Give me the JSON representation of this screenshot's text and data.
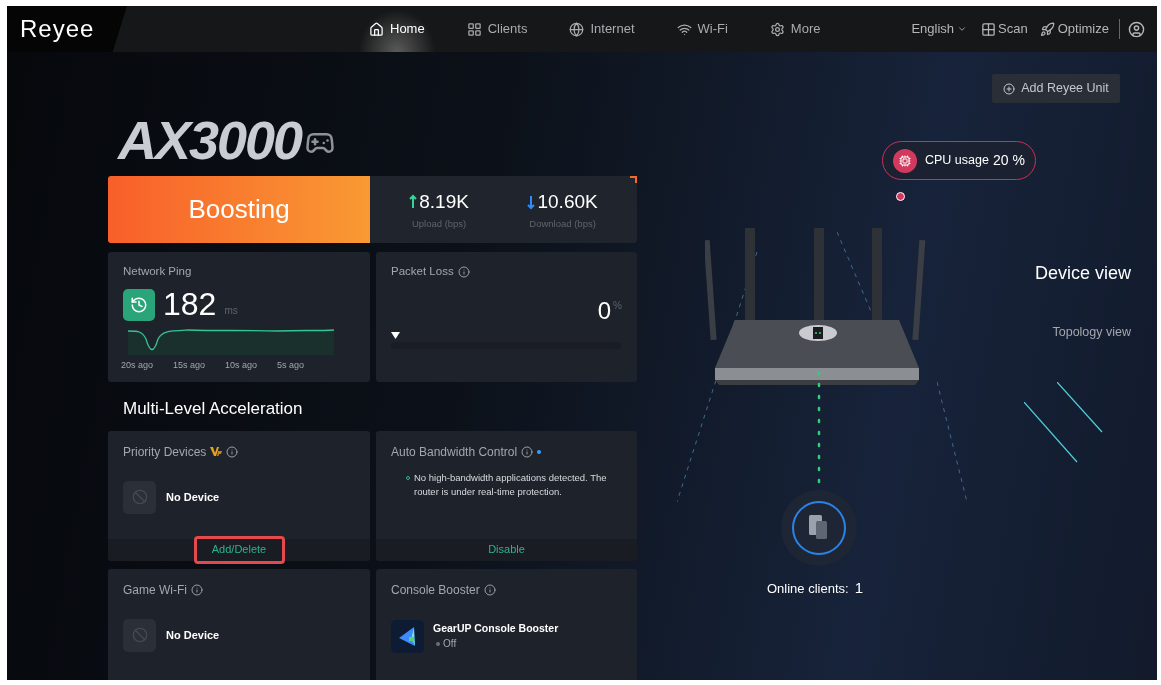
{
  "brand": "Reyee",
  "nav": [
    {
      "label": "Home",
      "selected": true
    },
    {
      "label": "Clients",
      "selected": false
    },
    {
      "label": "Internet",
      "selected": false
    },
    {
      "label": "Wi-Fi",
      "selected": false
    },
    {
      "label": "More",
      "selected": false
    }
  ],
  "toolbar": {
    "language": "English",
    "scan": "Scan",
    "optimize": "Optimize"
  },
  "product_logo": "AX3000",
  "boost": {
    "status": "Boosting",
    "upload": {
      "value": "8.19K",
      "label": "Upload (bps)"
    },
    "download": {
      "value": "10.60K",
      "label": "Download (bps)"
    }
  },
  "ping": {
    "title": "Network Ping",
    "value": "182",
    "unit": "ms",
    "time_labels": [
      "20s ago",
      "15s ago",
      "10s ago",
      "5s ago"
    ]
  },
  "packet_loss": {
    "title": "Packet Loss",
    "value": "0",
    "unit": "%",
    "level": 0
  },
  "section_title": "Multi-Level Acceleration",
  "cards": [
    {
      "kind": "device",
      "title": "Priority Devices",
      "vip": true,
      "empty_text": "No Device",
      "action": "Add/Delete",
      "highlighted": true
    },
    {
      "kind": "message",
      "title": "Auto Bandwidth Control",
      "dot": true,
      "message": "No high-bandwidth applications detected. The router is under real-time protection.",
      "action": "Disable",
      "highlighted": false
    },
    {
      "kind": "device",
      "title": "Game Wi-Fi",
      "vip": false,
      "empty_text": "No Device"
    },
    {
      "kind": "app",
      "title": "Console Booster",
      "app_name": "GearUP Console Booster",
      "status": "Off"
    }
  ],
  "add_unit": "Add Reyee Unit",
  "cpu": {
    "label": "CPU usage",
    "value": "20 %"
  },
  "views": [
    {
      "label": "Device view",
      "selected": true
    },
    {
      "label": "Topology view",
      "selected": false
    }
  ],
  "online_clients": {
    "label": "Online clients:",
    "count": "1"
  }
}
